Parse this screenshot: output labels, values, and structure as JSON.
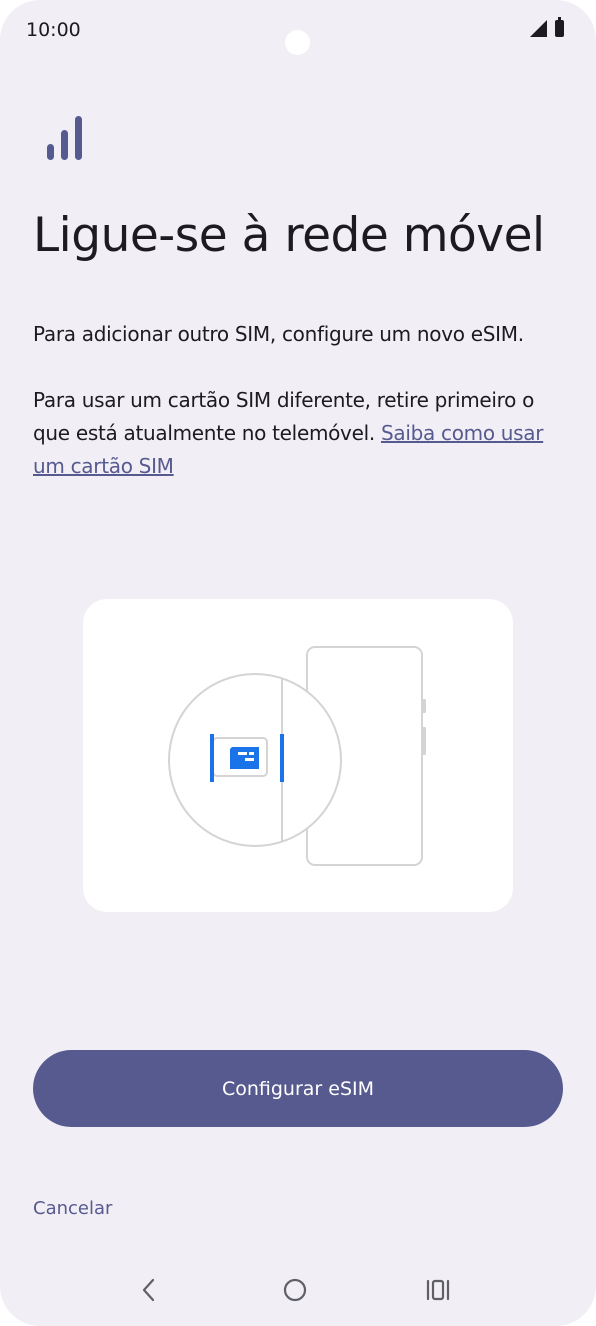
{
  "status_bar": {
    "time": "10:00",
    "icons": [
      "signal-icon",
      "battery-icon"
    ]
  },
  "header": {
    "icon": "cellular-signal-icon",
    "title": "Ligue-se à rede móvel"
  },
  "body": {
    "paragraph1": "Para adicionar outro SIM, configure um novo eSIM.",
    "paragraph2_text": "Para usar um cartão SIM diferente, retire primeiro o que está atualmente no telemóvel. ",
    "paragraph2_link": "Saiba como usar um cartão SIM"
  },
  "illustration": {
    "icon": "sim-card-tray-illustration",
    "accent_color": "#1a73e8"
  },
  "actions": {
    "primary_label": "Configurar eSIM",
    "secondary_label": "Cancelar"
  },
  "navigation": {
    "back_icon": "back-icon",
    "home_icon": "home-icon",
    "recent_icon": "recent-apps-icon"
  },
  "colors": {
    "background": "#f1eef5",
    "accent": "#565a8f",
    "button_text": "#ffffff",
    "text": "#1c1b1f"
  }
}
